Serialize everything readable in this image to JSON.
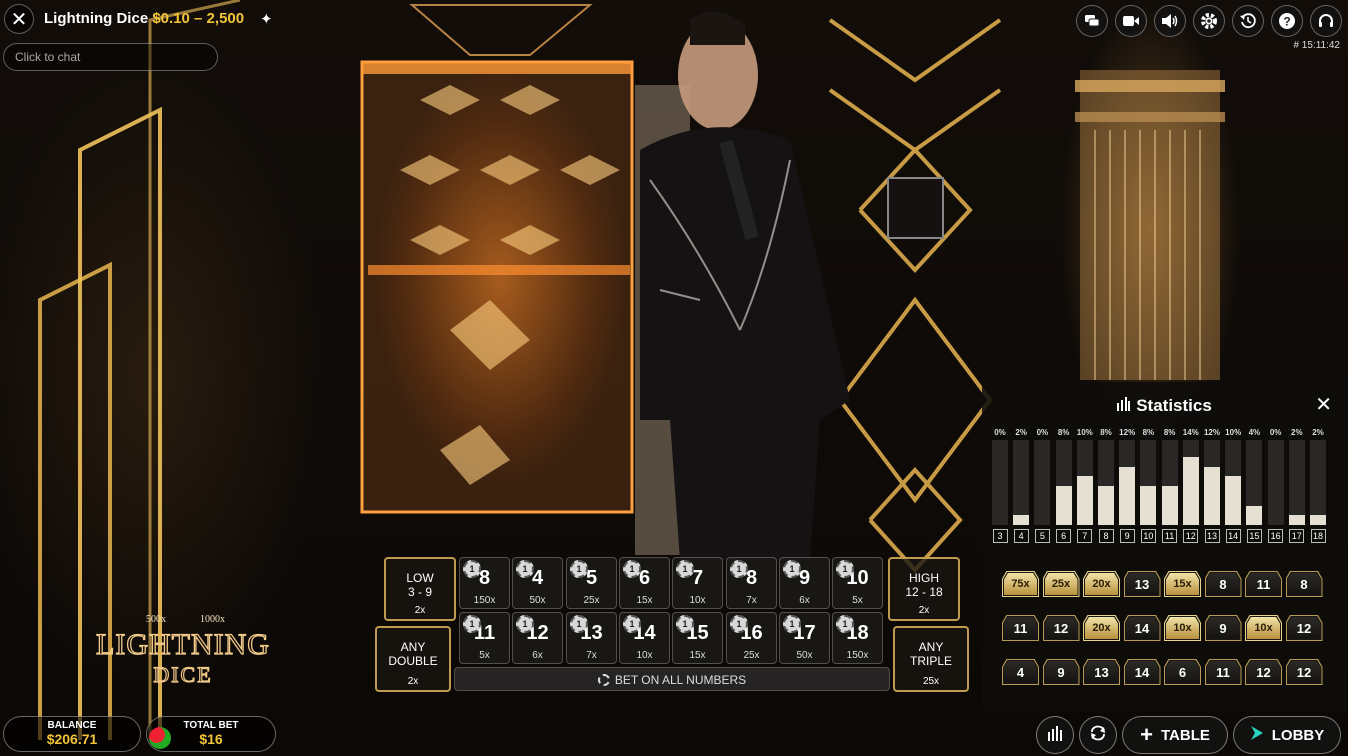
{
  "header": {
    "game_name": "Lightning Dice",
    "limits": "$0.10 – 2,500",
    "chat_placeholder": "Click to chat",
    "clock": "# 15:11:42"
  },
  "top_icons": [
    "chat-icon",
    "video-icon",
    "volume-icon",
    "settings-icon",
    "history-icon",
    "help-icon",
    "support-icon"
  ],
  "board": {
    "row1": [
      {
        "num": "8",
        "mul": "150x"
      },
      {
        "num": "4",
        "mul": "50x"
      },
      {
        "num": "5",
        "mul": "25x"
      },
      {
        "num": "6",
        "mul": "15x"
      },
      {
        "num": "7",
        "mul": "10x"
      },
      {
        "num": "8",
        "mul": "7x"
      },
      {
        "num": "9",
        "mul": "6x"
      },
      {
        "num": "10",
        "mul": "5x"
      }
    ],
    "row2": [
      {
        "num": "11",
        "mul": "5x"
      },
      {
        "num": "12",
        "mul": "6x"
      },
      {
        "num": "13",
        "mul": "7x"
      },
      {
        "num": "14",
        "mul": "10x"
      },
      {
        "num": "15",
        "mul": "15x"
      },
      {
        "num": "16",
        "mul": "25x"
      },
      {
        "num": "17",
        "mul": "50x"
      },
      {
        "num": "18",
        "mul": "150x"
      }
    ],
    "chip_value": "1",
    "low": {
      "line1": "LOW",
      "line2": "3 - 9",
      "mul": "2x"
    },
    "high": {
      "line1": "HIGH",
      "line2": "12 - 18",
      "mul": "2x"
    },
    "any_double": {
      "line1": "ANY",
      "line2": "DOUBLE",
      "mul": "2x"
    },
    "any_triple": {
      "line1": "ANY",
      "line2": "TRIPLE",
      "mul": "25x"
    },
    "bet_all": "BET ON ALL NUMBERS"
  },
  "statistics": {
    "title": "Statistics",
    "bars": [
      {
        "label": "3",
        "pct": "0%",
        "value": 0
      },
      {
        "label": "4",
        "pct": "2%",
        "value": 2
      },
      {
        "label": "5",
        "pct": "0%",
        "value": 0
      },
      {
        "label": "6",
        "pct": "8%",
        "value": 8
      },
      {
        "label": "7",
        "pct": "10%",
        "value": 10
      },
      {
        "label": "8",
        "pct": "8%",
        "value": 8
      },
      {
        "label": "9",
        "pct": "12%",
        "value": 12
      },
      {
        "label": "10",
        "pct": "8%",
        "value": 8
      },
      {
        "label": "11",
        "pct": "8%",
        "value": 8
      },
      {
        "label": "12",
        "pct": "14%",
        "value": 14
      },
      {
        "label": "13",
        "pct": "12%",
        "value": 12
      },
      {
        "label": "14",
        "pct": "10%",
        "value": 10
      },
      {
        "label": "15",
        "pct": "4%",
        "value": 4
      },
      {
        "label": "16",
        "pct": "0%",
        "value": 0
      },
      {
        "label": "17",
        "pct": "2%",
        "value": 2
      },
      {
        "label": "18",
        "pct": "2%",
        "value": 2
      }
    ],
    "results": [
      [
        {
          "t": "75x",
          "gold": true
        },
        {
          "t": "25x",
          "gold": true
        },
        {
          "t": "20x",
          "gold": true
        },
        {
          "t": "13",
          "gold": false
        },
        {
          "t": "15x",
          "gold": true
        },
        {
          "t": "8",
          "gold": false
        },
        {
          "t": "11",
          "gold": false
        },
        {
          "t": "8",
          "gold": false
        }
      ],
      [
        {
          "t": "11",
          "gold": false
        },
        {
          "t": "12",
          "gold": false
        },
        {
          "t": "20x",
          "gold": true
        },
        {
          "t": "14",
          "gold": false
        },
        {
          "t": "10x",
          "gold": true
        },
        {
          "t": "9",
          "gold": false
        },
        {
          "t": "10x",
          "gold": true
        },
        {
          "t": "12",
          "gold": false
        }
      ],
      [
        {
          "t": "4",
          "gold": false
        },
        {
          "t": "9",
          "gold": false
        },
        {
          "t": "13",
          "gold": false
        },
        {
          "t": "14",
          "gold": false
        },
        {
          "t": "6",
          "gold": false
        },
        {
          "t": "11",
          "gold": false
        },
        {
          "t": "12",
          "gold": false
        },
        {
          "t": "12",
          "gold": false
        }
      ]
    ]
  },
  "footer": {
    "balance_label": "BALANCE",
    "balance_value": "$206.71",
    "total_bet_label": "TOTAL BET",
    "total_bet_value": "$16",
    "table_label": "TABLE",
    "lobby_label": "LOBBY"
  },
  "logo": {
    "mult1": "500x",
    "mult2": "1000x",
    "word1": "LIGHTNING",
    "word2": "DICE"
  },
  "colors": {
    "gold": "#f3c43a",
    "lobby_accent": "#2ad4c4"
  }
}
